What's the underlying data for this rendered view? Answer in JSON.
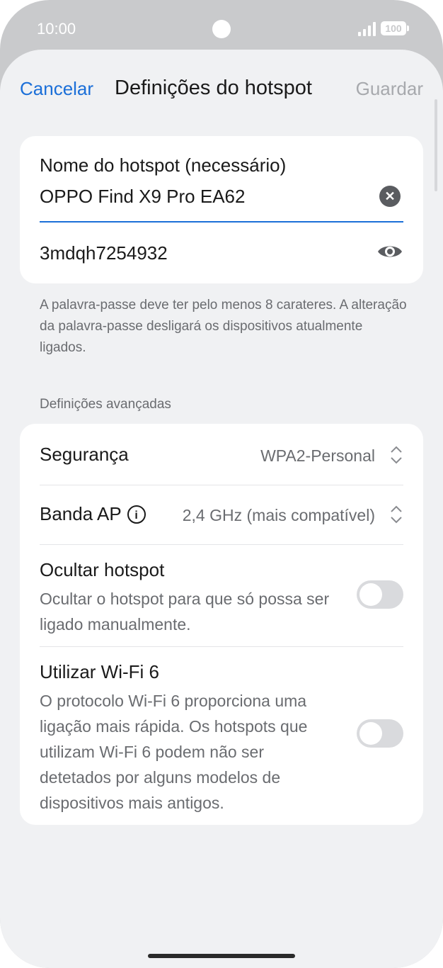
{
  "status_bar": {
    "time": "10:00",
    "battery": "100"
  },
  "header": {
    "cancel_label": "Cancelar",
    "title": "Definições do hotspot",
    "save_label": "Guardar"
  },
  "hotspot_card": {
    "name_label": "Nome do hotspot (necessário)",
    "name_value": "OPPO Find X9 Pro EA62",
    "password_value": "3mdqh7254932"
  },
  "password_help": "A palavra-passe deve ter pelo menos 8 carateres. A alteração da palavra-passe desligará os dispositivos atualmente ligados.",
  "advanced": {
    "section_label": "Definições avançadas",
    "security": {
      "title": "Segurança",
      "value": "WPA2-Personal"
    },
    "band": {
      "title": "Banda AP",
      "value": "2,4 GHz (mais compatível)"
    },
    "hide_hotspot": {
      "title": "Ocultar hotspot",
      "description": "Ocultar o hotspot para que só possa ser ligado manualmente.",
      "enabled": false
    },
    "wifi6": {
      "title": "Utilizar Wi-Fi 6",
      "description": "O protocolo Wi-Fi 6 proporciona uma ligação mais rápida. Os hotspots que utilizam Wi-Fi 6 podem não ser detetados por alguns modelos de dispositivos mais antigos.",
      "enabled": false
    }
  },
  "icons": {
    "clear": "clear-icon",
    "visibility": "eye-icon",
    "info": "info-icon",
    "updown": "chevron-updown-icon"
  },
  "colors": {
    "accent": "#1b6fd8",
    "background": "#f0f1f3",
    "card": "#ffffff"
  }
}
